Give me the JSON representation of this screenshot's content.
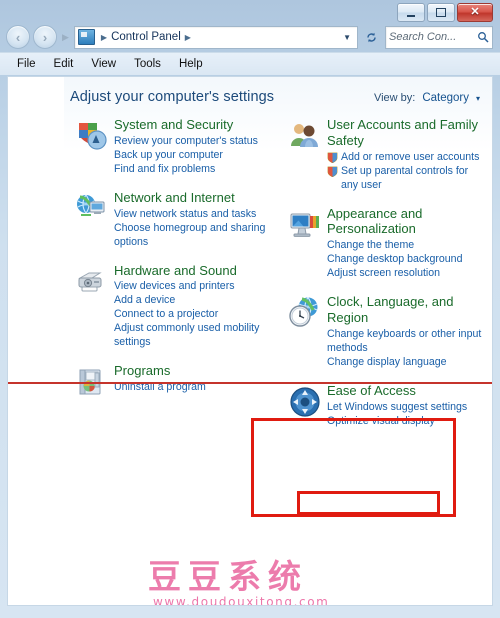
{
  "window": {
    "titlebar": {
      "minimize_label": "Minimize",
      "maximize_label": "Maximize",
      "close_label": "Close"
    },
    "nav": {
      "back_label": "Back",
      "forward_label": "Forward",
      "breadcrumb_root": "Control Panel",
      "breadcrumb_separator": "▸",
      "dropdown_glyph": "▼",
      "refresh_glyph": "↻",
      "address_icon": "control-panel-icon"
    },
    "search": {
      "placeholder": "Search Con...",
      "icon": "search-icon"
    },
    "menubar": {
      "items": [
        {
          "label": "File"
        },
        {
          "label": "Edit"
        },
        {
          "label": "View"
        },
        {
          "label": "Tools"
        },
        {
          "label": "Help"
        }
      ]
    }
  },
  "main": {
    "page_title": "Adjust your computer's settings",
    "view_by": {
      "label": "View by:",
      "value": "Category",
      "caret": "▾"
    },
    "categories_left": [
      {
        "icon": "shield-security-icon",
        "title": "System and Security",
        "links": [
          {
            "text": "Review your computer's status",
            "shield": false
          },
          {
            "text": "Back up your computer",
            "shield": false
          },
          {
            "text": "Find and fix problems",
            "shield": false
          }
        ]
      },
      {
        "icon": "network-globe-icon",
        "title": "Network and Internet",
        "links": [
          {
            "text": "View network status and tasks",
            "shield": false
          },
          {
            "text": "Choose homegroup and sharing options",
            "shield": false
          }
        ]
      },
      {
        "icon": "printer-hardware-icon",
        "title": "Hardware and Sound",
        "links": [
          {
            "text": "View devices and printers",
            "shield": false
          },
          {
            "text": "Add a device",
            "shield": false
          },
          {
            "text": "Connect to a projector",
            "shield": false
          },
          {
            "text": "Adjust commonly used mobility settings",
            "shield": false
          }
        ]
      },
      {
        "icon": "programs-box-icon",
        "title": "Programs",
        "links": [
          {
            "text": "Uninstall a program",
            "shield": false
          }
        ]
      }
    ],
    "categories_right": [
      {
        "icon": "user-accounts-icon",
        "title": "User Accounts and Family Safety",
        "links": [
          {
            "text": "Add or remove user accounts",
            "shield": true
          },
          {
            "text": "Set up parental controls for any user",
            "shield": true
          }
        ]
      },
      {
        "icon": "appearance-monitor-icon",
        "title": "Appearance and Personalization",
        "links": [
          {
            "text": "Change the theme",
            "shield": false
          },
          {
            "text": "Change desktop background",
            "shield": false
          },
          {
            "text": "Adjust screen resolution",
            "shield": false
          }
        ]
      },
      {
        "icon": "clock-globe-icon",
        "title": "Clock, Language, and Region",
        "links": [
          {
            "text": "Change keyboards or other input methods",
            "shield": false
          },
          {
            "text": "Change display language",
            "shield": false
          }
        ]
      },
      {
        "icon": "ease-of-access-icon",
        "title": "Ease of Access",
        "links": [
          {
            "text": "Let Windows suggest settings",
            "shield": false
          },
          {
            "text": "Optimize visual display",
            "shield": false
          }
        ]
      }
    ]
  },
  "annotations": {
    "highlight_color": "#e01b10",
    "underline_color": "#c5342c",
    "box_target": "Clock, Language, and Region",
    "inner_box_target": "Change display language"
  },
  "watermark": {
    "text_cn": "豆豆系统",
    "url": "www.doudouxitong.com",
    "color": "#ea69a0"
  }
}
